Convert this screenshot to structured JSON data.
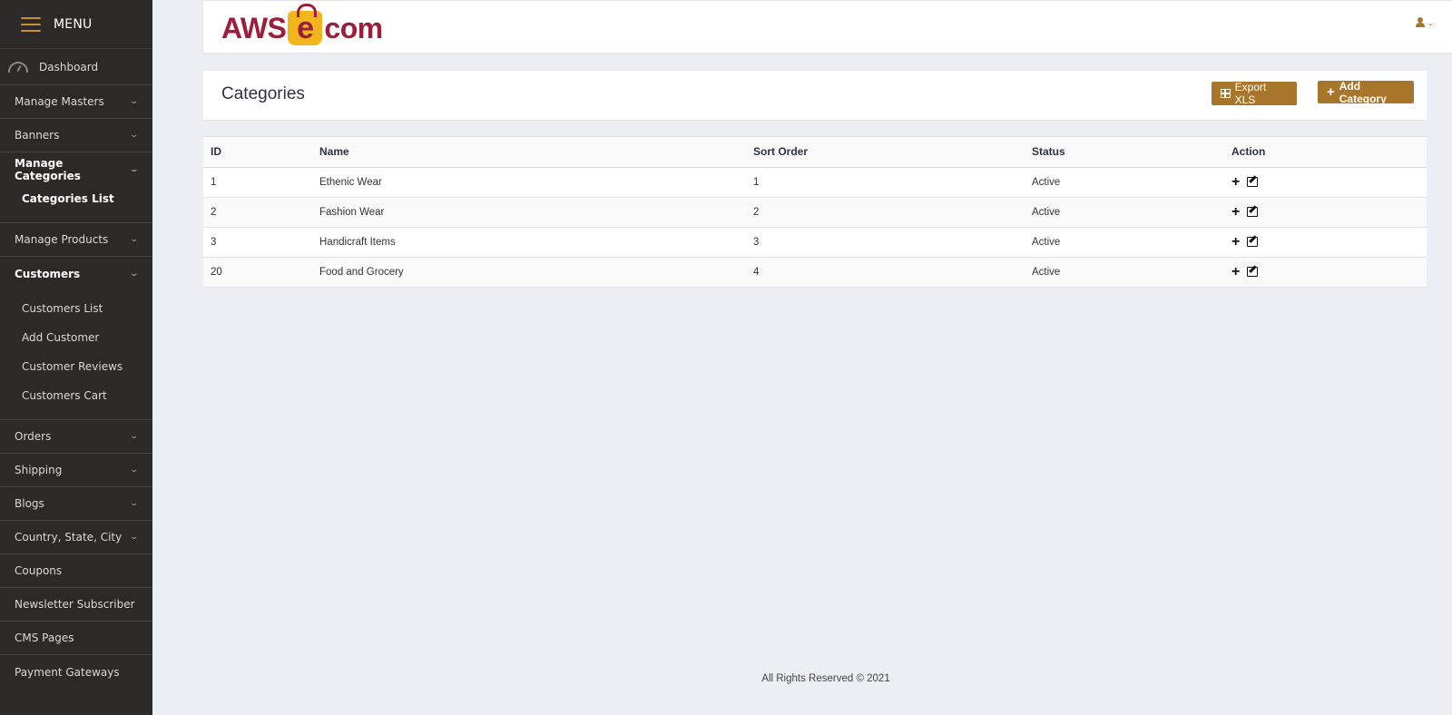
{
  "sidebar": {
    "menu_title": "MENU",
    "dashboard": "Dashboard",
    "items": [
      {
        "label": "Manage Masters"
      },
      {
        "label": "Banners"
      },
      {
        "label": "Manage Categories"
      },
      {
        "label": "Manage Products"
      },
      {
        "label": "Customers"
      },
      {
        "label": "Orders"
      },
      {
        "label": "Shipping"
      },
      {
        "label": "Blogs"
      },
      {
        "label": "Country, State, City"
      },
      {
        "label": "Coupons"
      },
      {
        "label": "Newsletter Subscriber"
      },
      {
        "label": "CMS Pages"
      },
      {
        "label": "Payment Gateways"
      }
    ],
    "categories_sub": [
      "Categories List"
    ],
    "customers_sub": [
      "Customers List",
      "Add Customer",
      "Customer Reviews",
      "Customers Cart"
    ]
  },
  "header": {
    "logo_left": "AWS",
    "logo_mid": "e",
    "logo_right": "com"
  },
  "page": {
    "title": "Categories",
    "export_label": "Export XLS",
    "add_label": "Add Category"
  },
  "table": {
    "columns": [
      "ID",
      "Name",
      "Sort Order",
      "Status",
      "Action"
    ],
    "rows": [
      {
        "id": "1",
        "name": "Ethenic Wear",
        "sort": "1",
        "status": "Active"
      },
      {
        "id": "2",
        "name": "Fashion Wear",
        "sort": "2",
        "status": "Active"
      },
      {
        "id": "3",
        "name": "Handicraft Items",
        "sort": "3",
        "status": "Active"
      },
      {
        "id": "20",
        "name": "Food and Grocery",
        "sort": "4",
        "status": "Active"
      }
    ]
  },
  "footer": {
    "text": "All Rights Reserved © 2021"
  },
  "colors": {
    "accent": "#a8762b",
    "sidebar_bg": "#2b2a29",
    "logo": "#9b1f3c",
    "logo_bag": "#f3b51c"
  }
}
